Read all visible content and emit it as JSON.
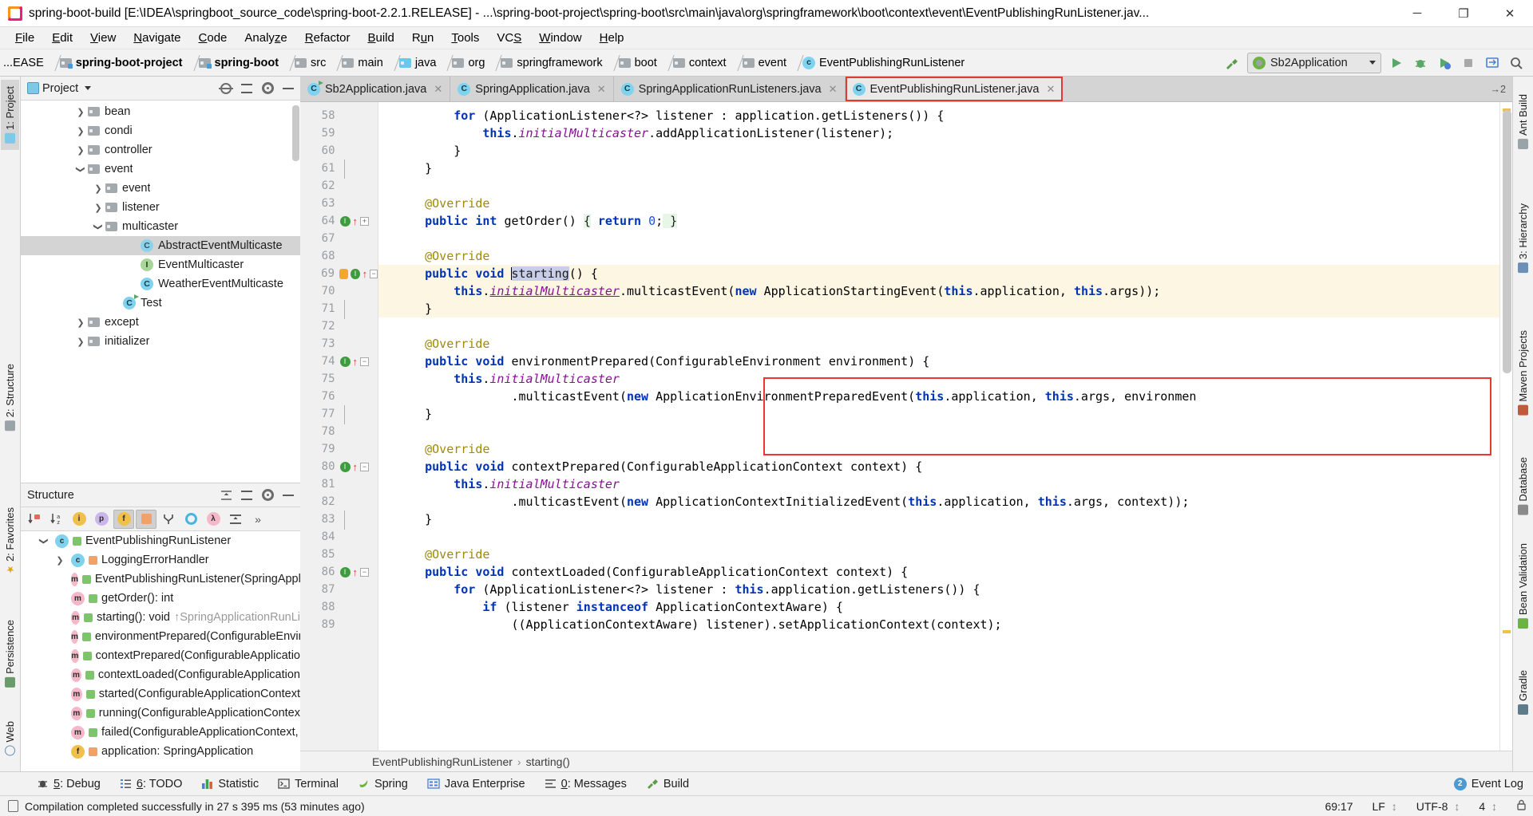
{
  "window": {
    "title": "spring-boot-build [E:\\IDEA\\springboot_source_code\\spring-boot-2.2.1.RELEASE] - ...\\spring-boot-project\\spring-boot\\src\\main\\java\\org\\springframework\\boot\\context\\event\\EventPublishingRunListener.jav...",
    "app_icon": "intellij-idea-icon",
    "minimize": "─",
    "maximize": "❐",
    "close": "✕"
  },
  "menubar": {
    "items": [
      "File",
      "Edit",
      "View",
      "Navigate",
      "Code",
      "Analyze",
      "Refactor",
      "Build",
      "Run",
      "Tools",
      "VCS",
      "Window",
      "Help"
    ]
  },
  "navbar": {
    "crumbs": [
      {
        "label": "...EASE",
        "icon": "none",
        "bold": false
      },
      {
        "label": "spring-boot-project",
        "icon": "module-folder",
        "bold": true
      },
      {
        "label": "spring-boot",
        "icon": "module-folder",
        "bold": true
      },
      {
        "label": "src",
        "icon": "folder",
        "bold": false
      },
      {
        "label": "main",
        "icon": "folder",
        "bold": false
      },
      {
        "label": "java",
        "icon": "source-folder",
        "bold": false
      },
      {
        "label": "org",
        "icon": "package-folder",
        "bold": false
      },
      {
        "label": "springframework",
        "icon": "package-folder",
        "bold": false
      },
      {
        "label": "boot",
        "icon": "package-folder",
        "bold": false
      },
      {
        "label": "context",
        "icon": "package-folder",
        "bold": false
      },
      {
        "label": "event",
        "icon": "package-folder",
        "bold": false
      },
      {
        "label": "EventPublishingRunListener",
        "icon": "java-class",
        "bold": false
      }
    ],
    "build_icon": "hammer-icon",
    "run_config": {
      "label": "Sb2Application",
      "icon": "spring-boot-icon",
      "chevron": "chevron-down-icon"
    },
    "buttons": [
      {
        "name": "run-button",
        "glyph": "▶",
        "color": "#4a9a3c"
      },
      {
        "name": "debug-button",
        "glyph": "🐞",
        "color": "#4a9a3c"
      },
      {
        "name": "run-with-coverage-button",
        "glyph": "▶",
        "color": "#4a9a3c"
      },
      {
        "name": "stop-button",
        "glyph": "■",
        "color": "#9a9a9a"
      },
      {
        "name": "update-app-button",
        "glyph": "↻",
        "color": "#4a7fd4"
      },
      {
        "name": "search-everywhere-button",
        "glyph": "🔍",
        "color": "#5c5c5c"
      }
    ]
  },
  "left_strip": {
    "tabs": [
      {
        "label": "1: Project",
        "icon": "project-icon",
        "active": true
      },
      {
        "label": "2: Structure",
        "icon": "structure-icon",
        "active": false
      },
      {
        "label": "2: Favorites",
        "icon": "favorites-icon",
        "active": false
      },
      {
        "label": "Persistence",
        "icon": "persistence-icon",
        "active": false
      },
      {
        "label": "Web",
        "icon": "web-icon",
        "active": false
      }
    ]
  },
  "right_strip": {
    "tabs": [
      {
        "label": "Ant Build",
        "icon": "ant-icon"
      },
      {
        "label": "3: Hierarchy",
        "icon": "hierarchy-icon"
      },
      {
        "label": "Maven Projects",
        "icon": "maven-icon"
      },
      {
        "label": "Database",
        "icon": "database-icon"
      },
      {
        "label": "Bean Validation",
        "icon": "bean-validation-icon"
      },
      {
        "label": "Gradle",
        "icon": "gradle-icon"
      }
    ]
  },
  "project_panel": {
    "title": "Project",
    "chevron": "chevron-down-icon",
    "header_buttons": [
      {
        "name": "scroll-from-source-button",
        "icon": "target-icon"
      },
      {
        "name": "collapse-all-button",
        "icon": "collapse-all-icon"
      },
      {
        "name": "settings-button",
        "icon": "gear-icon"
      },
      {
        "name": "hide-button",
        "icon": "minimize-icon"
      }
    ],
    "tree": [
      {
        "label": "bean",
        "icon": "package-folder",
        "indent": 3,
        "arrow": "collapsed",
        "selected": false
      },
      {
        "label": "condi",
        "icon": "package-folder",
        "indent": 3,
        "arrow": "collapsed",
        "selected": false
      },
      {
        "label": "controller",
        "icon": "package-folder",
        "indent": 3,
        "arrow": "collapsed",
        "selected": false
      },
      {
        "label": "event",
        "icon": "package-folder",
        "indent": 3,
        "arrow": "expanded",
        "selected": false
      },
      {
        "label": "event",
        "icon": "package-folder",
        "indent": 4,
        "arrow": "collapsed",
        "selected": false
      },
      {
        "label": "listener",
        "icon": "package-folder",
        "indent": 4,
        "arrow": "collapsed",
        "selected": false
      },
      {
        "label": "multicaster",
        "icon": "package-folder",
        "indent": 4,
        "arrow": "expanded",
        "selected": false
      },
      {
        "label": "AbstractEventMulticaste",
        "icon": "abstract-class",
        "indent": 6,
        "arrow": "none",
        "selected": true
      },
      {
        "label": "EventMulticaster",
        "icon": "java-interface",
        "indent": 6,
        "arrow": "none",
        "selected": false
      },
      {
        "label": "WeatherEventMulticaste",
        "icon": "java-class",
        "indent": 6,
        "arrow": "none",
        "selected": false
      },
      {
        "label": "Test",
        "icon": "runnable-class",
        "indent": 5,
        "arrow": "none",
        "selected": false
      },
      {
        "label": "except",
        "icon": "package-folder",
        "indent": 3,
        "arrow": "collapsed",
        "selected": false
      },
      {
        "label": "initializer",
        "icon": "package-folder",
        "indent": 3,
        "arrow": "collapsed",
        "selected": false
      }
    ]
  },
  "structure_panel": {
    "title": "Structure",
    "header_buttons": [
      {
        "name": "expand-all-button",
        "icon": "expand-all-icon"
      },
      {
        "name": "collapse-all-button",
        "icon": "collapse-all-icon"
      },
      {
        "name": "settings-button",
        "icon": "gear-icon"
      },
      {
        "name": "hide-button",
        "icon": "minimize-icon"
      }
    ],
    "toolbar": [
      {
        "name": "sort-by-visibility-button",
        "icon": "sort-visibility-icon",
        "on": false
      },
      {
        "name": "sort-alphabetically-button",
        "icon": "sort-alpha-icon",
        "on": false
      },
      {
        "name": "show-inherited-button",
        "icon": "inherited-icon",
        "on": false
      },
      {
        "name": "show-properties-button",
        "icon": "properties-icon",
        "on": false
      },
      {
        "name": "show-fields-button",
        "icon": "fields-icon",
        "on": true
      },
      {
        "name": "show-non-public-button",
        "icon": "non-public-icon",
        "on": true
      },
      {
        "name": "group-methods-button",
        "icon": "group-methods-icon",
        "on": false
      },
      {
        "name": "show-anonymous-button",
        "icon": "anonymous-icon",
        "on": false
      },
      {
        "name": "show-lambdas-button",
        "icon": "lambda-icon",
        "on": false
      },
      {
        "name": "expand-all-button-2",
        "icon": "expand-all-icon",
        "on": false
      },
      {
        "name": "more-button",
        "icon": "chevron-double-right-icon",
        "on": false
      }
    ],
    "tree": [
      {
        "label": "EventPublishingRunListener",
        "suffix": "",
        "icon": "java-class",
        "vis": "public",
        "indent": 1,
        "arrow": "expanded"
      },
      {
        "label": "LoggingErrorHandler",
        "suffix": "",
        "icon": "inner-class",
        "vis": "private",
        "indent": 2,
        "arrow": "collapsed"
      },
      {
        "label": "EventPublishingRunListener(SpringAppli",
        "suffix": "",
        "icon": "method",
        "vis": "public",
        "indent": 2,
        "arrow": "none"
      },
      {
        "label": "getOrder(): int",
        "suffix": "",
        "icon": "method",
        "vis": "public",
        "indent": 2,
        "arrow": "none"
      },
      {
        "label": "starting(): void",
        "suffix": "↑SpringApplicationRunLi",
        "icon": "method",
        "vis": "public",
        "indent": 2,
        "arrow": "none"
      },
      {
        "label": "environmentPrepared(ConfigurableEnvir",
        "suffix": "",
        "icon": "method",
        "vis": "public",
        "indent": 2,
        "arrow": "none"
      },
      {
        "label": "contextPrepared(ConfigurableApplicatio",
        "suffix": "",
        "icon": "method",
        "vis": "public",
        "indent": 2,
        "arrow": "none"
      },
      {
        "label": "contextLoaded(ConfigurableApplication",
        "suffix": "",
        "icon": "method",
        "vis": "public",
        "indent": 2,
        "arrow": "none"
      },
      {
        "label": "started(ConfigurableApplicationContext",
        "suffix": "",
        "icon": "method",
        "vis": "public",
        "indent": 2,
        "arrow": "none"
      },
      {
        "label": "running(ConfigurableApplicationContex",
        "suffix": "",
        "icon": "method",
        "vis": "public",
        "indent": 2,
        "arrow": "none"
      },
      {
        "label": "failed(ConfigurableApplicationContext, ",
        "suffix": "",
        "icon": "method",
        "vis": "public",
        "indent": 2,
        "arrow": "none"
      },
      {
        "label": "application: SpringApplication",
        "suffix": "",
        "icon": "field",
        "vis": "private",
        "indent": 2,
        "arrow": "none"
      }
    ]
  },
  "editor": {
    "tabs": [
      {
        "label": "Sb2Application.java",
        "icon": "runnable-class",
        "close": "✕",
        "active": false,
        "highlight": false
      },
      {
        "label": "SpringApplication.java",
        "icon": "java-class",
        "close": "✕",
        "active": false,
        "highlight": false
      },
      {
        "label": "SpringApplicationRunListeners.java",
        "icon": "java-class",
        "close": "✕",
        "active": false,
        "highlight": false
      },
      {
        "label": "EventPublishingRunListener.java",
        "icon": "java-class",
        "close": "✕",
        "active": true,
        "highlight": true
      }
    ],
    "tab_overflow": "→2",
    "highlight_color": "#e8392c",
    "breadcrumb": [
      "EventPublishingRunListener",
      "starting()"
    ],
    "breadcrumb_sep": "›",
    "lines": [
      {
        "num": "58",
        "marks": [],
        "html": "<span class=\"pl\">        </span><span class=\"kw\">for</span><span class=\"pl\"> (ApplicationListener&lt;?&gt; listener : application.getListeners()) {</span>",
        "hl": false
      },
      {
        "num": "59",
        "marks": [],
        "html": "<span class=\"pl\">            </span><span class=\"kw\">this</span><span class=\"pl\">.</span><span class=\"fld\">initialMulticaster</span><span class=\"pl\">.addApplicationListener(listener);</span>",
        "hl": false
      },
      {
        "num": "60",
        "marks": [],
        "html": "<span class=\"pl\">        }</span>",
        "hl": false
      },
      {
        "num": "61",
        "marks": [
          "fold-end"
        ],
        "html": "<span class=\"pl\">    }</span>",
        "hl": false
      },
      {
        "num": "62",
        "marks": [],
        "html": "",
        "hl": false
      },
      {
        "num": "63",
        "marks": [],
        "html": "<span class=\"anno\">    @Override</span>",
        "hl": false
      },
      {
        "num": "64",
        "marks": [
          "override",
          "fold-plus"
        ],
        "html": "<span class=\"pl\">    </span><span class=\"kw\">public</span><span class=\"pl\"> </span><span class=\"kw\">int</span><span class=\"pl\"> getOrder() </span><span class=\"hl-green\">{</span><span class=\"pl\"> </span><span class=\"kw\">return</span><span class=\"pl\"> </span><span class=\"num\">0</span><span class=\"pl\">;</span><span class=\"hl-green\"> }</span>",
        "hl": false
      },
      {
        "num": "67",
        "marks": [],
        "html": "",
        "hl": false
      },
      {
        "num": "68",
        "marks": [],
        "html": "<span class=\"anno\">    @Override</span>",
        "hl": false
      },
      {
        "num": "69",
        "marks": [
          "bulb",
          "override",
          "fold-open"
        ],
        "html": "<span class=\"pl\">    </span><span class=\"kw\">public</span><span class=\"pl\"> </span><span class=\"kw\">void</span><span class=\"pl\"> </span><span class=\"caret-bar\"></span><span class=\"sel\">starting</span><span class=\"pl\">() {</span>",
        "hl": true
      },
      {
        "num": "70",
        "marks": [],
        "html": "<span class=\"pl\">        </span><span class=\"kw\">this</span><span class=\"pl\">.</span><span class=\"fld-u\">initialMulticaster</span><span class=\"pl\">.multicastEvent(</span><span class=\"kw\">new</span><span class=\"pl\"> ApplicationStartingEvent(</span><span class=\"kw\">this</span><span class=\"pl\">.application, </span><span class=\"kw\">this</span><span class=\"pl\">.args));</span>",
        "hl": true
      },
      {
        "num": "71",
        "marks": [
          "fold-end"
        ],
        "html": "<span class=\"pl\">    }</span>",
        "hl": true
      },
      {
        "num": "72",
        "marks": [],
        "html": "",
        "hl": false
      },
      {
        "num": "73",
        "marks": [],
        "html": "<span class=\"anno\">    @Override</span>",
        "hl": false
      },
      {
        "num": "74",
        "marks": [
          "override",
          "fold-open"
        ],
        "html": "<span class=\"pl\">    </span><span class=\"kw\">public</span><span class=\"pl\"> </span><span class=\"kw\">void</span><span class=\"pl\"> environmentPrepared(ConfigurableEnvironment environment) {</span>",
        "hl": false
      },
      {
        "num": "75",
        "marks": [],
        "html": "<span class=\"pl\">        </span><span class=\"kw\">this</span><span class=\"pl\">.</span><span class=\"fld\">initialMulticaster</span>",
        "hl": false
      },
      {
        "num": "76",
        "marks": [],
        "html": "<span class=\"pl\">                .multicastEvent(</span><span class=\"kw\">new</span><span class=\"pl\"> ApplicationEnvironmentPreparedEvent(</span><span class=\"kw\">this</span><span class=\"pl\">.application, </span><span class=\"kw\">this</span><span class=\"pl\">.args, environmen</span>",
        "hl": false
      },
      {
        "num": "77",
        "marks": [
          "fold-end"
        ],
        "html": "<span class=\"pl\">    }</span>",
        "hl": false
      },
      {
        "num": "78",
        "marks": [],
        "html": "",
        "hl": false
      },
      {
        "num": "79",
        "marks": [],
        "html": "<span class=\"anno\">    @Override</span>",
        "hl": false
      },
      {
        "num": "80",
        "marks": [
          "override",
          "fold-open"
        ],
        "html": "<span class=\"pl\">    </span><span class=\"kw\">public</span><span class=\"pl\"> </span><span class=\"kw\">void</span><span class=\"pl\"> contextPrepared(ConfigurableApplicationContext context) {</span>",
        "hl": false
      },
      {
        "num": "81",
        "marks": [],
        "html": "<span class=\"pl\">        </span><span class=\"kw\">this</span><span class=\"pl\">.</span><span class=\"fld\">initialMulticaster</span>",
        "hl": false
      },
      {
        "num": "82",
        "marks": [],
        "html": "<span class=\"pl\">                .multicastEvent(</span><span class=\"kw\">new</span><span class=\"pl\"> ApplicationContextInitializedEvent(</span><span class=\"kw\">this</span><span class=\"pl\">.application, </span><span class=\"kw\">this</span><span class=\"pl\">.args, context));</span>",
        "hl": false
      },
      {
        "num": "83",
        "marks": [
          "fold-end"
        ],
        "html": "<span class=\"pl\">    }</span>",
        "hl": false
      },
      {
        "num": "84",
        "marks": [],
        "html": "",
        "hl": false
      },
      {
        "num": "85",
        "marks": [],
        "html": "<span class=\"anno\">    @Override</span>",
        "hl": false
      },
      {
        "num": "86",
        "marks": [
          "override",
          "fold-open"
        ],
        "html": "<span class=\"pl\">    </span><span class=\"kw\">public</span><span class=\"pl\"> </span><span class=\"kw\">void</span><span class=\"pl\"> contextLoaded(ConfigurableApplicationContext context) {</span>",
        "hl": false
      },
      {
        "num": "87",
        "marks": [],
        "html": "<span class=\"pl\">        </span><span class=\"kw\">for</span><span class=\"pl\"> (ApplicationListener&lt;?&gt; listener : </span><span class=\"kw\">this</span><span class=\"pl\">.application.getListeners()) {</span>",
        "hl": false
      },
      {
        "num": "88",
        "marks": [],
        "html": "<span class=\"pl\">            </span><span class=\"kw\">if</span><span class=\"pl\"> (listener </span><span class=\"kw\">instanceof</span><span class=\"pl\"> ApplicationContextAware) {</span>",
        "hl": false
      },
      {
        "num": "89",
        "marks": [],
        "html": "<span class=\"pl\">                ((ApplicationContextAware) listener).setApplicationContext(context);</span>",
        "hl": false
      }
    ]
  },
  "bottom_bar": {
    "items": [
      {
        "label": "5: Debug",
        "icon": "debug-icon",
        "underline": "5"
      },
      {
        "label": "6: TODO",
        "icon": "todo-icon",
        "underline": "6"
      },
      {
        "label": "Statistic",
        "icon": "statistic-icon",
        "underline": ""
      },
      {
        "label": "Terminal",
        "icon": "terminal-icon",
        "underline": ""
      },
      {
        "label": "Spring",
        "icon": "spring-icon",
        "underline": ""
      },
      {
        "label": "Java Enterprise",
        "icon": "java-enterprise-icon",
        "underline": ""
      },
      {
        "label": "0: Messages",
        "icon": "messages-icon",
        "underline": "0"
      },
      {
        "label": "Build",
        "icon": "build-icon",
        "underline": ""
      }
    ],
    "event_log": {
      "label": "Event Log",
      "badge": "2"
    }
  },
  "statusbar": {
    "message": "Compilation completed successfully in 27 s 395 ms (53 minutes ago)",
    "message_icon": "document-icon",
    "caret_position": "69:17",
    "line_separator": "LF",
    "encoding": "UTF-8",
    "indent": "4",
    "lock_icon": "lock-icon",
    "divider": "↕"
  }
}
